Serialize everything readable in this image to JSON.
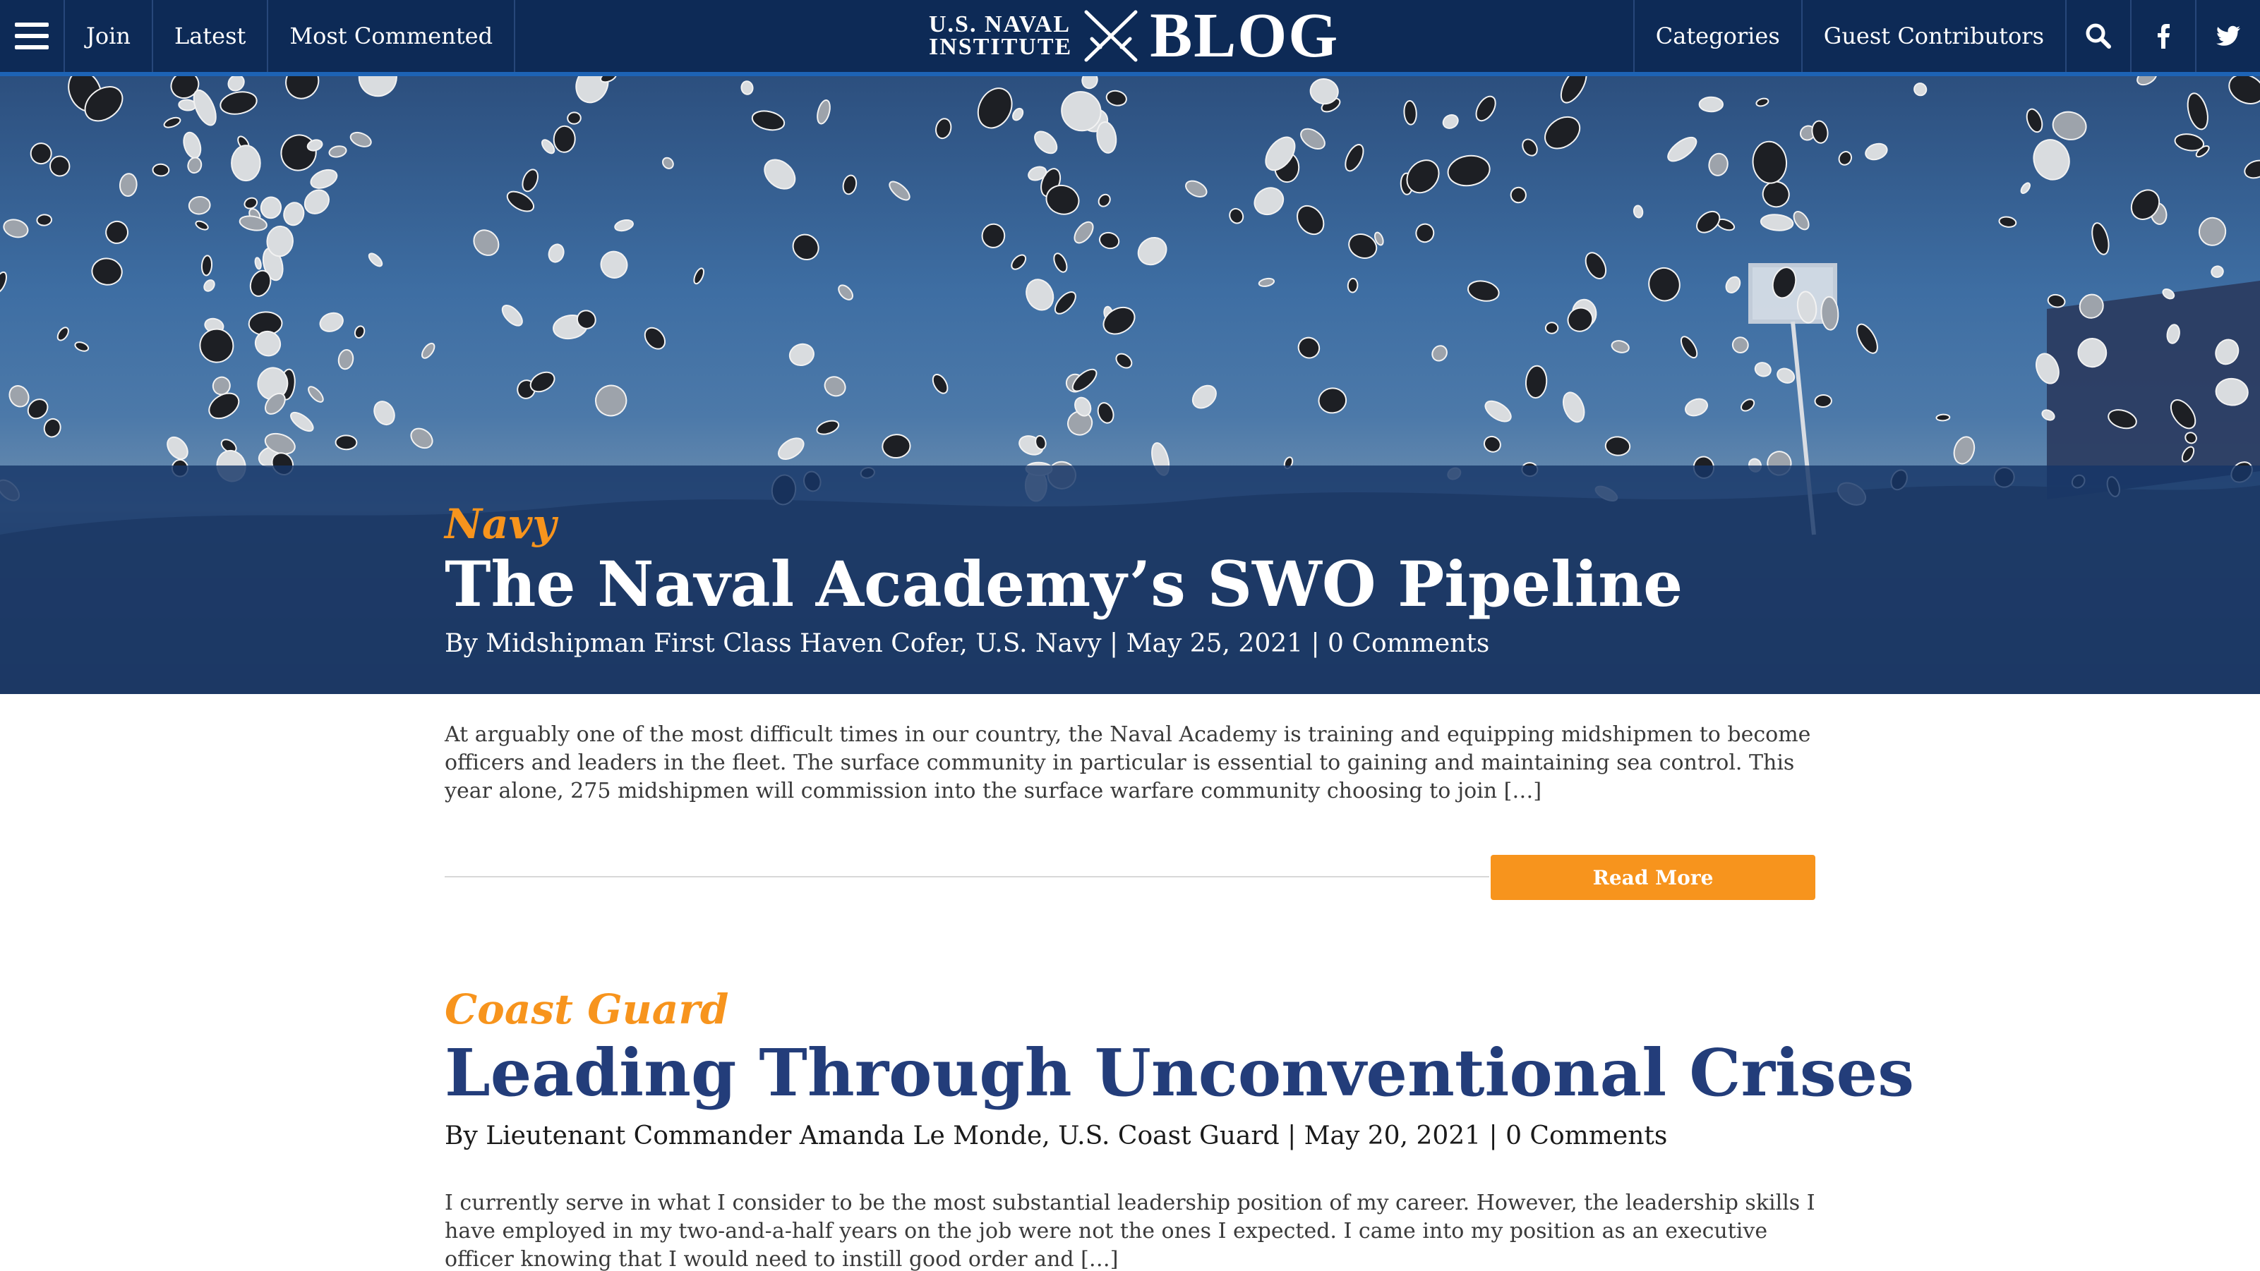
{
  "nav": {
    "menu_icon": "hamburger-menu-icon",
    "left_items": [
      "Join",
      "Latest",
      "Most Commented"
    ],
    "brand": {
      "line1": "U.S. NAVAL",
      "line2": "INSTITUTE",
      "logo_icon": "crossed-swords-icon",
      "title": "BLOG"
    },
    "right_items": [
      "Categories",
      "Guest Contributors"
    ],
    "icons": [
      "search-icon",
      "facebook-icon",
      "twitter-icon"
    ]
  },
  "hero": {
    "category": "Navy",
    "title": "The Naval Academy’s SWO Pipeline",
    "meta": "By Midshipman First Class Haven Cofer, U.S. Navy | May 25, 2021 | 0 Comments",
    "excerpt": "At arguably one of the most difficult times in our country, the Naval Academy is training and equipping midshipmen to become officers and leaders in the fleet. The surface community in particular is essential to gaining and maintaining sea control. This year alone, 275 midshipmen will commission into the surface warfare community choosing to join […]",
    "read_more": "Read More"
  },
  "post2": {
    "category": "Coast Guard",
    "title": "Leading Through Unconventional Crises",
    "meta": "By Lieutenant Commander Amanda Le Monde, U.S. Coast Guard | May 20, 2021 | 0 Comments",
    "excerpt": "I currently serve in what I consider to be the most substantial leadership position of my career. However, the leadership skills I have employed in my two-and-a-half years on the job were not the ones I expected. I came into my position as an executive officer knowing that I would need to instill good order and […]"
  },
  "colors": {
    "nav_bg": "#0d2a56",
    "nav_accent": "#1d63b5",
    "category_orange": "#f7941d",
    "title_blue": "#233d7a"
  }
}
